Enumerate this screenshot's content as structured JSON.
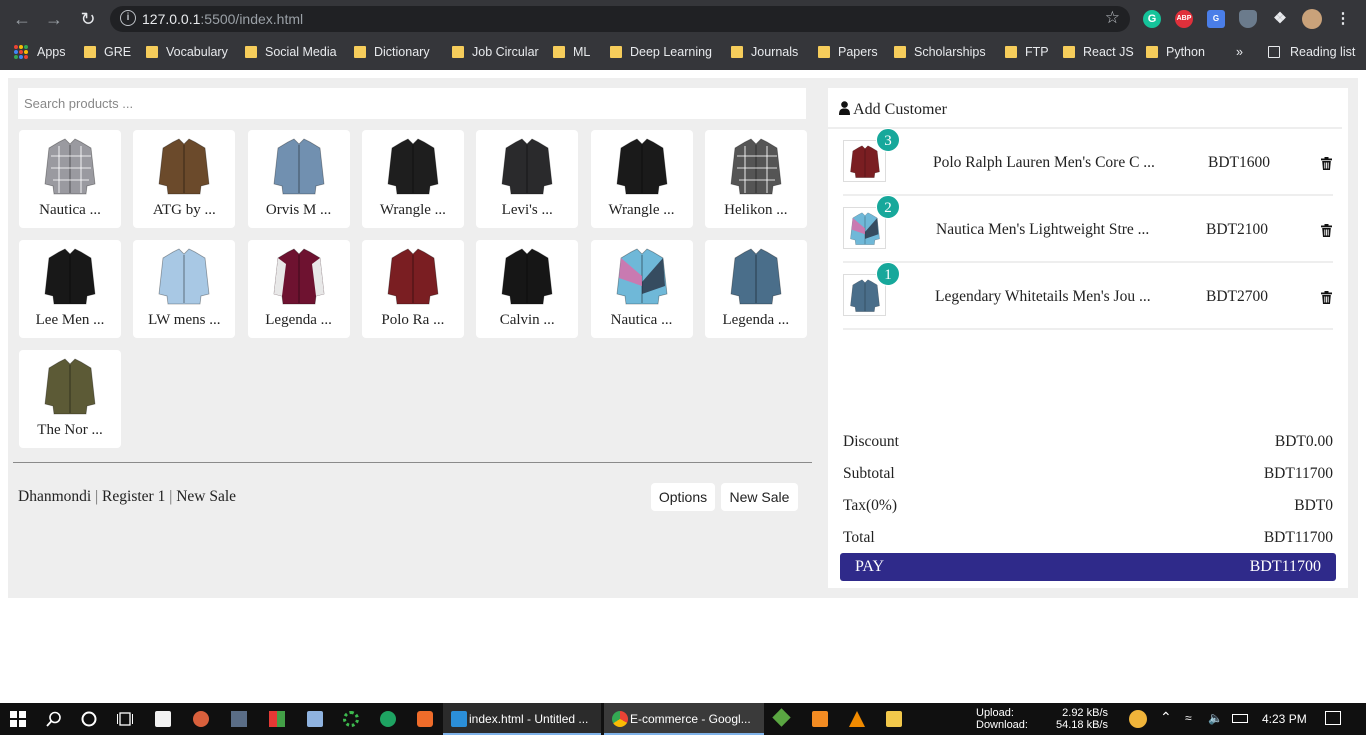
{
  "browser": {
    "url_host": "127.0.0.1",
    "url_rest": ":5500/index.html",
    "bookmarks": [
      "Apps",
      "GRE",
      "Vocabulary",
      "Social Media",
      "Dictionary",
      "Job Circular",
      "ML",
      "Deep Learning",
      "Journals",
      "Papers",
      "Scholarships",
      "FTP",
      "React JS",
      "Python"
    ],
    "more": "»",
    "reading_list": "Reading list",
    "ext_abp": "ABP"
  },
  "search": {
    "placeholder": "Search products ..."
  },
  "products": [
    {
      "name": "Nautica ...",
      "color": "#9a9aa0",
      "pattern": "plaid"
    },
    {
      "name": "ATG by ...",
      "color": "#6b4a2b",
      "pattern": "solid"
    },
    {
      "name": "Orvis M ...",
      "color": "#7190b0",
      "pattern": "solid"
    },
    {
      "name": "Wrangle ...",
      "color": "#1e1e1e",
      "pattern": "solid"
    },
    {
      "name": "Levi's ...",
      "color": "#2a2a2c",
      "pattern": "solid"
    },
    {
      "name": "Wrangle ...",
      "color": "#1a1a1a",
      "pattern": "solid"
    },
    {
      "name": "Helikon ...",
      "color": "#555",
      "pattern": "plaid"
    },
    {
      "name": "Lee Men ...",
      "color": "#181818",
      "pattern": "solid"
    },
    {
      "name": "LW mens ...",
      "color": "#a8c8e4",
      "pattern": "solid"
    },
    {
      "name": "Legenda ...",
      "color": "#6e1230",
      "pattern": "varsity"
    },
    {
      "name": "Polo Ra ...",
      "color": "#7a1e22",
      "pattern": "solid"
    },
    {
      "name": "Calvin ...",
      "color": "#161616",
      "pattern": "solid"
    },
    {
      "name": "Nautica ...",
      "color": "#6fb8d8",
      "pattern": "multi"
    },
    {
      "name": "Legenda ...",
      "color": "#4a6e8a",
      "pattern": "solid"
    },
    {
      "name": "The Nor ...",
      "color": "#5c5a36",
      "pattern": "solid"
    }
  ],
  "footer": {
    "location": "Dhanmondi",
    "sep": "|",
    "register": "Register 1",
    "sale": "New Sale",
    "options_button": "Options",
    "new_sale_button": "New Sale"
  },
  "cart": {
    "add_customer": "Add Customer",
    "items": [
      {
        "qty": "3",
        "name": "Polo Ralph Lauren Men's Core C ...",
        "price": "BDT1600",
        "color": "#7a1e22"
      },
      {
        "qty": "2",
        "name": "Nautica Men's Lightweight Stre ...",
        "price": "BDT2100",
        "color": "#6fb8d8"
      },
      {
        "qty": "1",
        "name": "Legendary Whitetails Men's Jou ...",
        "price": "BDT2700",
        "color": "#4a6e8a"
      }
    ],
    "summary": {
      "discount_label": "Discount",
      "discount": "BDT0.00",
      "subtotal_label": "Subtotal",
      "subtotal": "BDT11700",
      "tax_label": "Tax(0%)",
      "tax": "BDT0",
      "total_label": "Total",
      "total": "BDT11700"
    },
    "pay_label": "PAY",
    "pay_amount": "BDT11700"
  },
  "taskbar": {
    "task_vscode": "index.html - Untitled ...",
    "task_chrome": "E-commerce - Googl...",
    "upload_label": "Upload:",
    "download_label": "Download:",
    "upload_speed": "2.92 kB/s",
    "download_speed": "54.18 kB/s",
    "time": "4:23 PM"
  }
}
